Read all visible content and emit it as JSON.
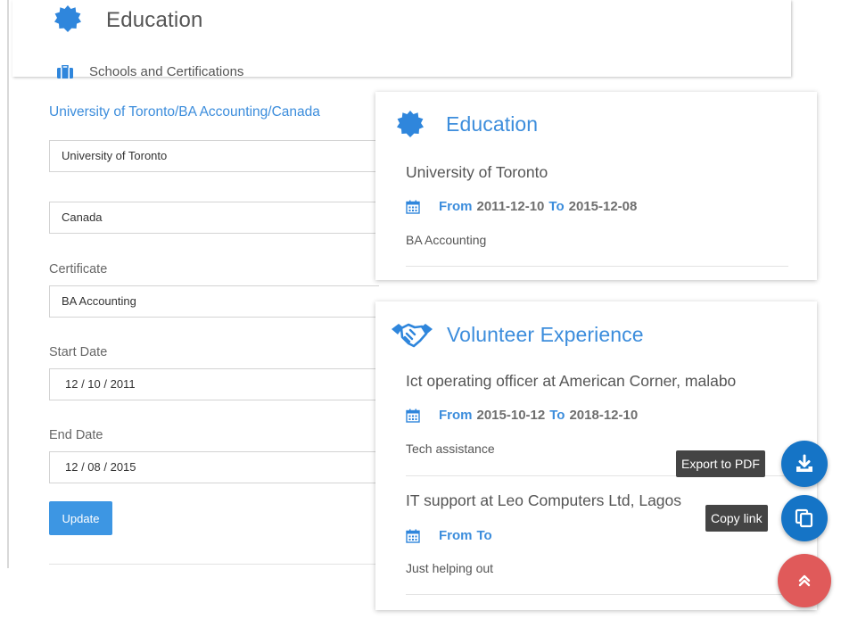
{
  "back_panel": {
    "title": "Education",
    "icon": "education-badge-icon"
  },
  "form": {
    "section_label": "Schools and Certifications",
    "section_icon": "briefcase-icon",
    "school_link": "University of Toronto/BA Accounting/Canada",
    "school_value": "University of Toronto",
    "country_value": "Canada",
    "certificate_label": "Certificate",
    "certificate_value": "BA Accounting",
    "start_label": "Start Date",
    "start_value": "12 / 10 / 2011",
    "end_label": "End Date",
    "end_value": "12 / 08 / 2015",
    "update_label": "Update"
  },
  "education_card": {
    "title": "Education",
    "icon": "education-badge-icon",
    "entries": [
      {
        "title": "University of Toronto",
        "from_kw": "From",
        "from": "2011-12-10",
        "to_kw": "To",
        "to": "2015-12-08",
        "desc": "BA Accounting"
      }
    ]
  },
  "volunteer_card": {
    "title": "Volunteer Experience",
    "icon": "handshake-icon",
    "entries": [
      {
        "title": "Ict operating officer at American Corner, malabo",
        "from_kw": "From",
        "from": "2015-10-12",
        "to_kw": "To",
        "to": "2018-12-10",
        "desc": "Tech assistance"
      },
      {
        "title": "IT support at Leo Computers Ltd, Lagos",
        "from_kw": "From",
        "to_kw": "To",
        "desc": "Just helping out"
      }
    ]
  },
  "actions": {
    "export_tip": "Export to PDF",
    "copy_tip": "Copy link",
    "export_icon": "download-icon",
    "copy_icon": "copy-icon",
    "top_icon": "double-chevron-up-icon"
  },
  "colors": {
    "accent": "#3c8ddc",
    "fab_blue": "#1574c6",
    "fab_red": "#e05a5a"
  }
}
